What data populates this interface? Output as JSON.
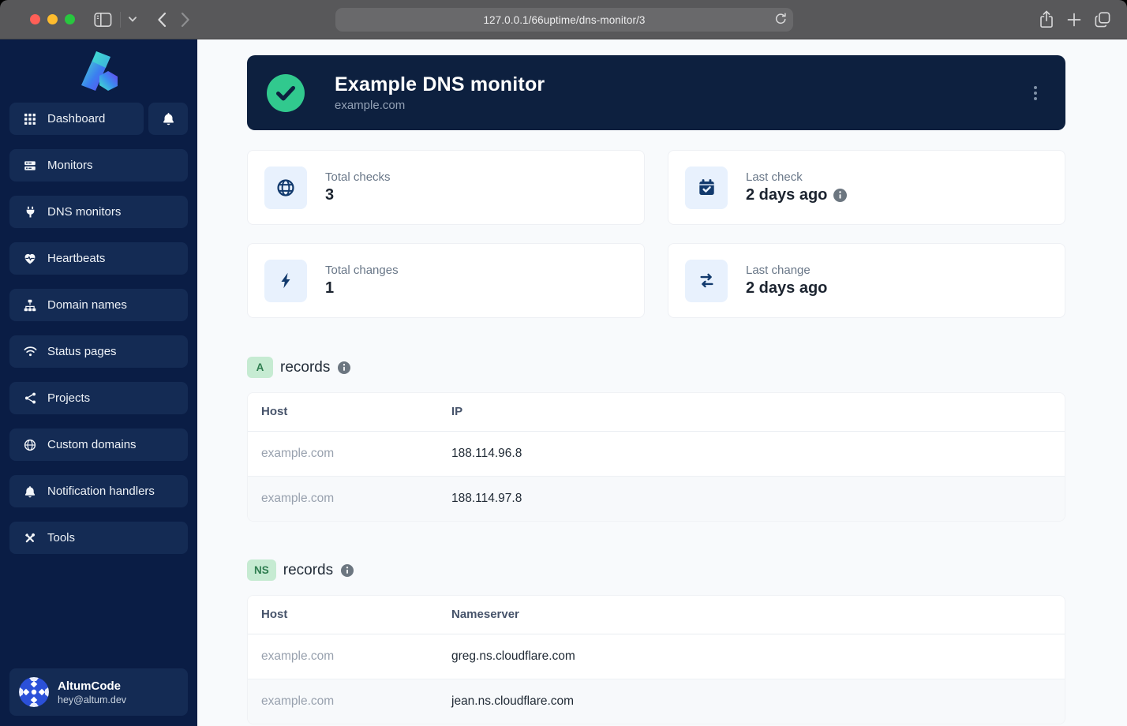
{
  "browser": {
    "url": "127.0.0.1/66uptime/dns-monitor/3"
  },
  "sidebar": {
    "items": [
      {
        "label": "Dashboard"
      },
      {
        "label": "Monitors"
      },
      {
        "label": "DNS monitors"
      },
      {
        "label": "Heartbeats"
      },
      {
        "label": "Domain names"
      },
      {
        "label": "Status pages"
      },
      {
        "label": "Projects"
      },
      {
        "label": "Custom domains"
      },
      {
        "label": "Notification handlers"
      },
      {
        "label": "Tools"
      }
    ],
    "user": {
      "name": "AltumCode",
      "email": "hey@altum.dev"
    }
  },
  "hero": {
    "title": "Example DNS monitor",
    "subtitle": "example.com",
    "status": "up"
  },
  "stats": [
    {
      "label": "Total checks",
      "value": "3"
    },
    {
      "label": "Last check",
      "value": "2 days ago",
      "has_info": true
    },
    {
      "label": "Total changes",
      "value": "1"
    },
    {
      "label": "Last change",
      "value": "2 days ago"
    }
  ],
  "sections": [
    {
      "badge": "A",
      "title": "records",
      "columns": [
        "Host",
        "IP"
      ],
      "rows": [
        [
          "example.com",
          "188.114.96.8"
        ],
        [
          "example.com",
          "188.114.97.8"
        ]
      ]
    },
    {
      "badge": "NS",
      "title": "records",
      "columns": [
        "Host",
        "Nameserver"
      ],
      "rows": [
        [
          "example.com",
          "greg.ns.cloudflare.com"
        ],
        [
          "example.com",
          "jean.ns.cloudflare.com"
        ]
      ]
    }
  ],
  "colors": {
    "accent_green": "#31c98e",
    "sidebar_navy": "#0a1d45",
    "nav_item_navy": "#142b54",
    "hero_navy": "#0d203f",
    "badge_green_bg": "#c6ebd2",
    "badge_green_text": "#2e7d4f",
    "stat_tile_blue": "#e8f1fd",
    "stat_icon_navy": "#123a6d",
    "page_bg": "#f8fafc"
  }
}
